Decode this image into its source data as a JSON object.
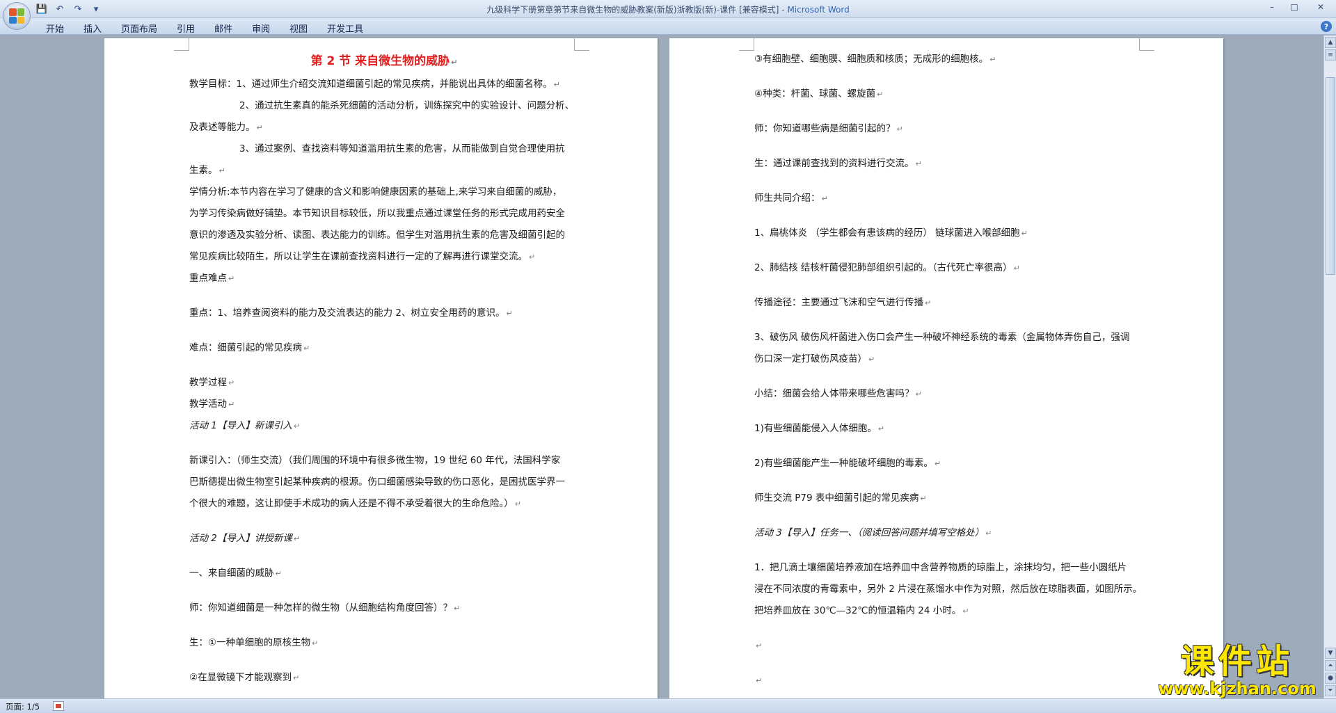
{
  "window": {
    "title": "九级科学下册第章第节来自微生物的威胁教案(新版)浙教版(新)-课件 [兼容模式] - ",
    "app_name": "Microsoft Word"
  },
  "ribbon": {
    "tabs": [
      "开始",
      "插入",
      "页面布局",
      "引用",
      "邮件",
      "审阅",
      "视图",
      "开发工具"
    ]
  },
  "page1": {
    "title": "第 2 节  来自微生物的威胁",
    "lines": [
      "教学目标：1、通过师生介绍交流知道细菌引起的常见疾病，并能说出具体的细菌名称。",
      "2、通过抗生素真的能杀死细菌的活动分析，训练探究中的实验设计、问题分析、",
      "及表述等能力。",
      "3、通过案例、查找资料等知道滥用抗生素的危害，从而能做到自觉合理使用抗",
      "生素。",
      "学情分析:本节内容在学习了健康的含义和影响健康因素的基础上,来学习来自细菌的威胁，",
      "为学习传染病做好铺垫。本节知识目标较低，所以我重点通过课堂任务的形式完成用药安全",
      "意识的渗透及实验分析、读图、表达能力的训练。但学生对滥用抗生素的危害及细菌引起的",
      "常见疾病比较陌生，所以让学生在课前查找资料进行一定的了解再进行课堂交流。",
      "重点难点",
      "重点：1、培养查阅资料的能力及交流表达的能力 2、树立安全用药的意识。",
      "难点：细菌引起的常见疾病",
      "教学过程",
      "教学活动",
      "活动 1【导入】新课引入",
      "新课引入：（师生交流）（我们周围的环境中有很多微生物，19 世纪 60 年代，法国科学家",
      "巴斯德提出微生物室引起某种疾病的根源。伤口细菌感染导致的伤口恶化，是困扰医学界一",
      "个很大的难题，这让即使手术成功的病人还是不得不承受着很大的生命危险。）",
      "活动 2【导入】讲授新课",
      "一、来自细菌的威胁",
      "师：你知道细菌是一种怎样的微生物（从细胞结构角度回答）？",
      "生：①一种单细胞的原核生物",
      "②在显微镜下才能观察到"
    ]
  },
  "page2": {
    "lines": [
      "③有细胞壁、细胞膜、细胞质和核质；无成形的细胞核。",
      "④种类：杆菌、球菌、螺旋菌",
      "师：你知道哪些病是细菌引起的？",
      "生：通过课前查找到的资料进行交流。",
      "师生共同介绍：",
      "1、扁桃体炎 （学生都会有患该病的经历） 链球菌进入喉部细胞",
      "2、肺结核 结核杆菌侵犯肺部组织引起的。（古代死亡率很高）",
      "传播途径：主要通过飞沫和空气进行传播",
      "3、破伤风 破伤风杆菌进入伤口会产生一种破坏神经系统的毒素（金属物体弄伤自己，强调",
      "伤口深一定打破伤风疫苗）",
      "小结：细菌会给人体带来哪些危害吗？",
      "1)有些细菌能侵入人体细胞。",
      "2)有些细菌能产生一种能破坏细胞的毒素。",
      "师生交流 P79 表中细菌引起的常见疾病",
      "活动 3【导入】任务一、（阅读回答问题并填写空格处）",
      "1．把几滴土壤细菌培养液加在培养皿中含营养物质的琼脂上，涂抹均匀，把一些小圆纸片",
      "浸在不同浓度的青霉素中，另外 2 片浸在蒸馏水中作为对照，然后放在琼脂表面，如图所示。",
      "把培养皿放在 30℃—32℃的恒温箱内 24 小时。",
      "",
      ""
    ]
  },
  "status": {
    "page_indicator": "页面: 1/5"
  },
  "watermark": {
    "text": "课件站",
    "url": "www.kjzhan.com"
  },
  "colors": {
    "title_red": "#e02020",
    "watermark_yellow": "#ffe800",
    "workspace_bg": "#9eabba"
  }
}
